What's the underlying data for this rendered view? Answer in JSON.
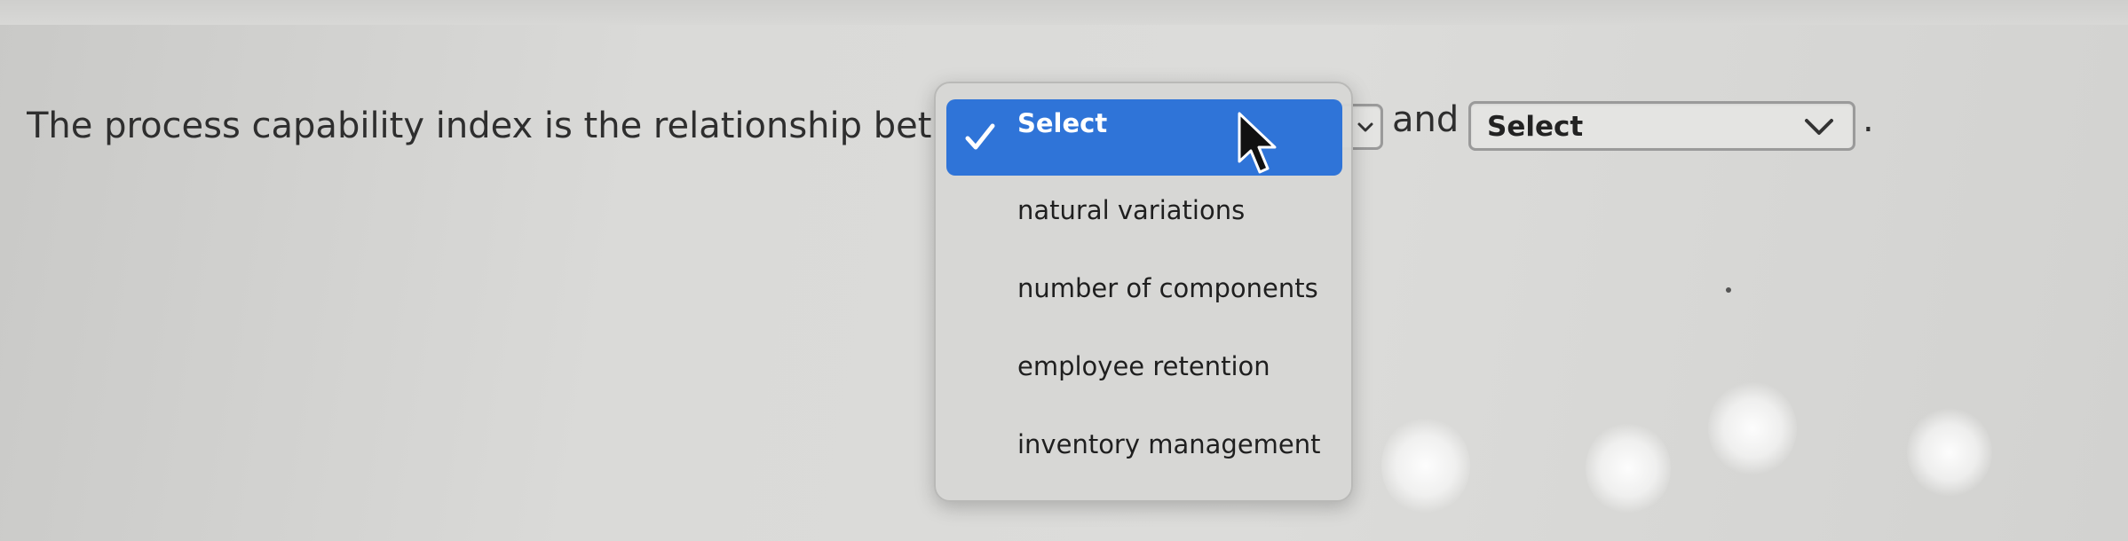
{
  "question": {
    "text_before": "The process capability index is the relationship between",
    "text_between": "and",
    "text_after": "."
  },
  "select_1": {
    "value": "Select",
    "expanded": true
  },
  "select_2": {
    "value": "Select",
    "expanded": false
  },
  "dropdown": {
    "selected_option": "Select",
    "options": [
      "natural variations",
      "number of components",
      "employee retention",
      "inventory management"
    ]
  },
  "colors": {
    "highlight": "#2f74d8",
    "text": "#2e2e2e"
  },
  "icons": {
    "check": "checkmark-icon",
    "cursor": "mouse-pointer-icon",
    "chevron": "chevron-down-icon"
  }
}
